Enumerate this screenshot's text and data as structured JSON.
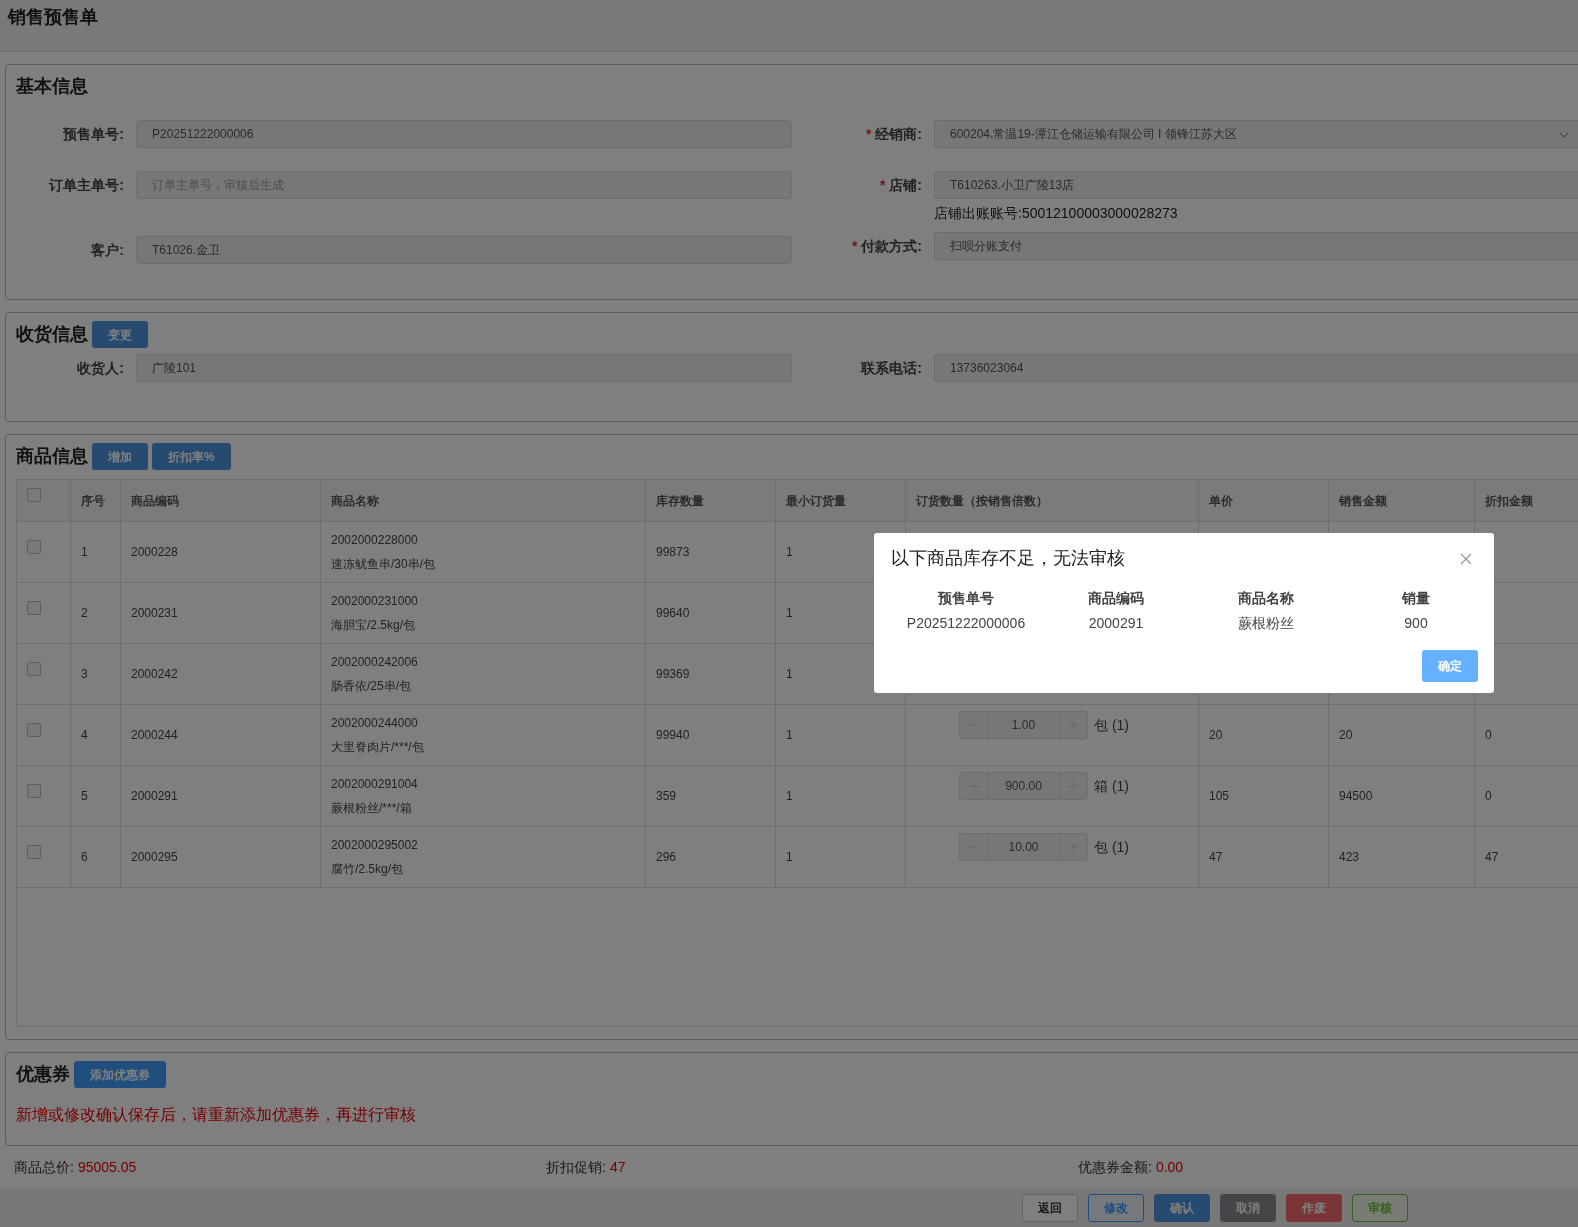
{
  "page_title": "销售预售单",
  "basic_info": {
    "title": "基本信息",
    "left_fields": [
      {
        "label": "预售单号:",
        "value": "P20251222000006"
      },
      {
        "label": "订单主单号:",
        "placeholder": "订单主单号，审核后生成"
      },
      {
        "label": "客户:",
        "value": "T61026.金卫"
      }
    ],
    "right_fields": [
      {
        "label": "经销商:",
        "value": "600204.常温19-潭江仓储运输有限公司 I 领锋江苏大区",
        "required_mark": "*",
        "kind": "select"
      },
      {
        "label": "店铺:",
        "value": "T610263.小卫广陵13店",
        "required_mark": "*",
        "kind": "input",
        "note": "店铺出账账号:50012100003000028273"
      },
      {
        "label": "付款方式:",
        "value": "扫呗分账支付",
        "required_mark": "*",
        "kind": "input"
      }
    ]
  },
  "delivery_info": {
    "title": "收货信息",
    "button": "变更",
    "fields": [
      {
        "label": "收货人:",
        "value": "广陵101"
      },
      {
        "label": "联系电话:",
        "value": "13736023064"
      }
    ]
  },
  "goods_info": {
    "title": "商品信息",
    "buttons": [
      "增加",
      "折扣率%"
    ],
    "table": {
      "select_all_checked": false,
      "columns": [
        "序号",
        "商品编码",
        "商品名称",
        "库存数量",
        "最小订货量",
        "订货数量（按销售倍数）",
        "单价",
        "销售金额",
        "折扣金额"
      ],
      "rows": [
        {
          "checked": false,
          "no": "1",
          "code": "2000228",
          "barcode": "2002000228000",
          "name": "速冻鱿鱼串/30串/包",
          "stock": "99873",
          "min_qty": "1"
        },
        {
          "checked": false,
          "no": "2",
          "code": "2000231",
          "barcode": "2002000231000",
          "name": "海胆宝/2.5kg/包",
          "stock": "99640",
          "min_qty": "1"
        },
        {
          "checked": false,
          "no": "3",
          "code": "2000242",
          "barcode": "2002000242006",
          "name": "肠香依/25串/包",
          "stock": "99369",
          "min_qty": "1"
        },
        {
          "checked": false,
          "no": "4",
          "code": "2000244",
          "barcode": "2002000244000",
          "name": "大里脊肉片/***/包",
          "stock": "99940",
          "min_qty": "1",
          "qty": "1.00",
          "unit": "包 (1)",
          "price": "20",
          "amount": "20",
          "discount": "0"
        },
        {
          "checked": false,
          "no": "5",
          "code": "2000291",
          "barcode": "2002000291004",
          "name": "蕨根粉丝/***/箱",
          "stock": "359",
          "min_qty": "1",
          "qty": "900.00",
          "unit": "箱 (1)",
          "price": "105",
          "amount": "94500",
          "discount": "0"
        },
        {
          "checked": false,
          "no": "6",
          "code": "2000295",
          "barcode": "2002000295002",
          "name": "腐竹/2.5kg/包",
          "stock": "296",
          "min_qty": "1",
          "qty": "10.00",
          "unit": "包 (1)",
          "price": "47",
          "amount": "423",
          "discount": "47"
        }
      ]
    }
  },
  "coupon": {
    "title": "优惠券",
    "button": "添加优惠券",
    "warning": "新增或修改确认保存后，请重新添加优惠券，再进行审核"
  },
  "totals": [
    {
      "label": "商品总价:",
      "value": "95005.05"
    },
    {
      "label": "折扣促销:",
      "value": "47"
    },
    {
      "label": "优惠券金额:",
      "value": "0.00"
    }
  ],
  "actions": [
    {
      "label": "返回",
      "kind": "default"
    },
    {
      "label": "修改",
      "kind": "plain-blue"
    },
    {
      "label": "确认",
      "kind": "blue-disabled"
    },
    {
      "label": "取消",
      "kind": "gray"
    },
    {
      "label": "作废",
      "kind": "red"
    },
    {
      "label": "审核",
      "kind": "plain-green"
    }
  ],
  "dialog": {
    "title": "以下商品库存不足，无法审核",
    "columns": [
      "预售单号",
      "商品编码",
      "商品名称",
      "销量"
    ],
    "rows": [
      [
        "P20251222000006",
        "2000291",
        "蕨根粉丝",
        "900"
      ]
    ],
    "button": "确定"
  }
}
